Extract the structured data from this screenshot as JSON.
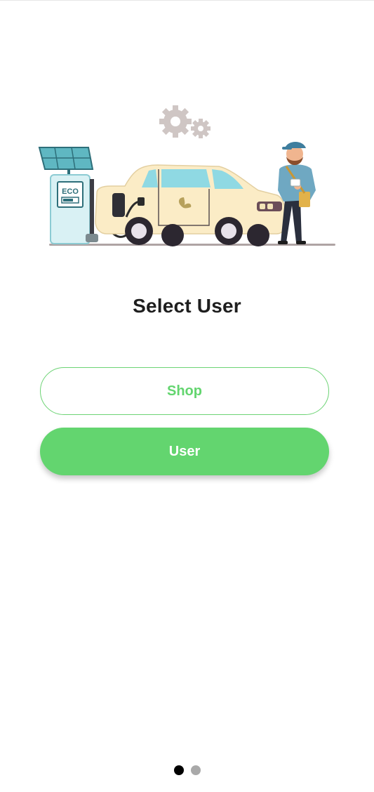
{
  "title": "Select User",
  "illustration": {
    "station_label": "ECO",
    "description_icon": "ev-charging-illustration"
  },
  "buttons": {
    "shop_label": "Shop",
    "user_label": "User"
  },
  "pagination": {
    "current_page": 1,
    "total_pages": 2
  },
  "colors": {
    "accent": "#63d56f",
    "title": "#1e1e1e",
    "dot_active": "#000000",
    "dot_inactive": "#a9a9a9"
  }
}
